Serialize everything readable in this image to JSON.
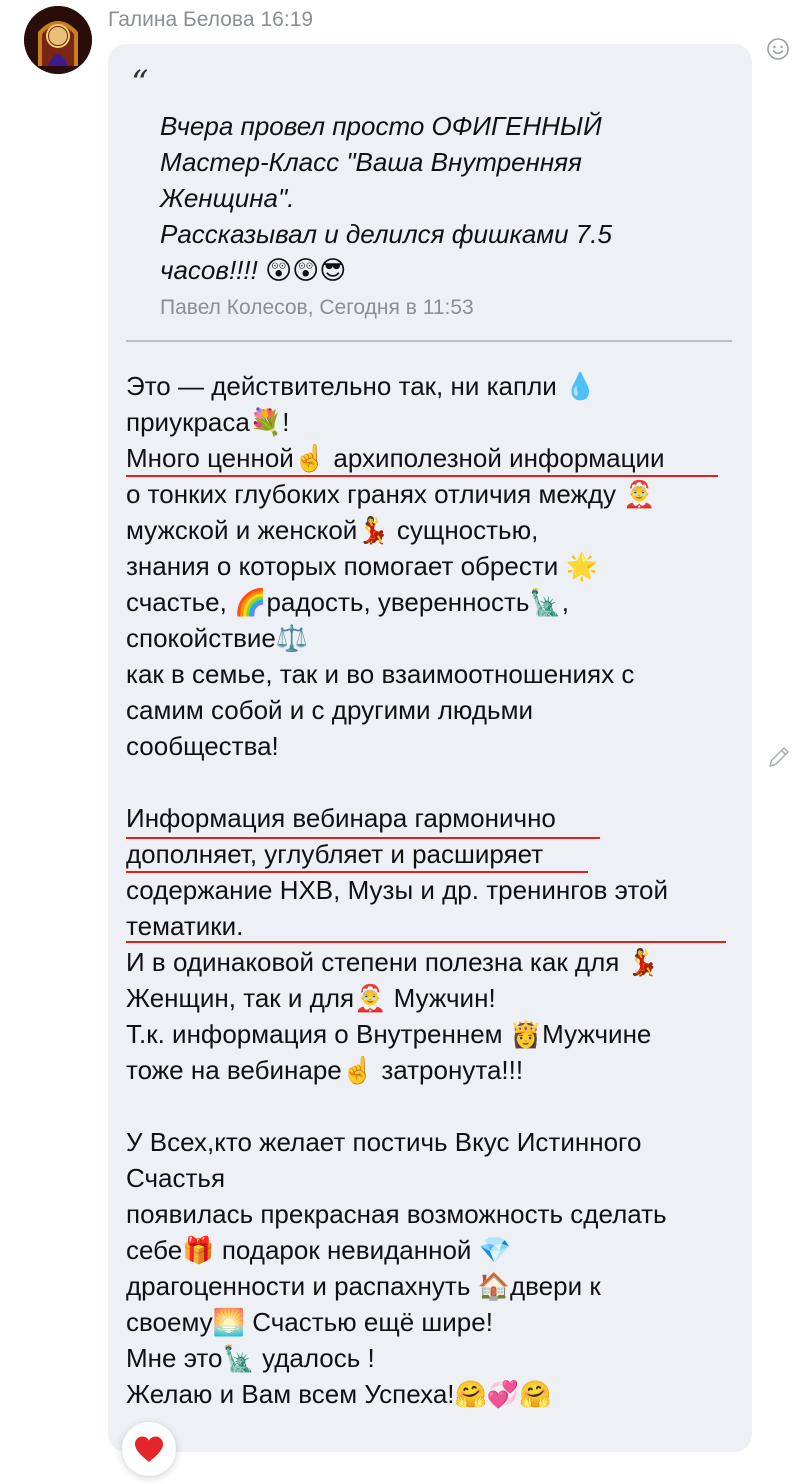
{
  "header": {
    "author": "Галина Белова",
    "time": "16:19"
  },
  "quote": {
    "mark": "“",
    "lines": [
      "Вчера провел просто ОФИГЕННЫЙ",
      "Мастер-Класс \"Ваша Внутренняя",
      "Женщина\".",
      "Рассказывал и делился фишками 7.5",
      "часов!!!! 😲😲😎"
    ],
    "author": "Павел Колесов, Сегодня в 11:53"
  },
  "message": {
    "lines": [
      "Это — действительно так, ни капли 💧",
      "приукраса💐!",
      "Много ценной☝️ архиполезной информации",
      "о тонких глубоких гранях отличия между 🤶",
      "мужской и женской💃 сущностью,",
      "знания о которых помогает обрести 🌟",
      "счастье, 🌈радость, уверенность🗽,",
      "спокойствие⚖️",
      "как в семье, так и во взаимоотношениях с",
      "самим собой и с другими людьми",
      "сообщества!",
      "",
      "Информация вебинара гармонично",
      "дополняет, углубляет и расширяет",
      "содержание НХВ, Музы и др. тренингов этой",
      "тематики.",
      "И в одинаковой степени полезна как для 💃",
      "Женщин, так и для🤶 Мужчин!",
      "Т.к. информация о Внутреннем 👸Мужчине",
      "тоже на вебинаре☝️ затронута!!!",
      "",
      "У Всех,кто желает постичь Вкус Истинного",
      "Счастья",
      "появилась прекрасная возможность сделать",
      "себе🎁 подарок невиданной 💎",
      "драгоценности и распахнуть 🏠двери к",
      "своему🌅 Счастью ещё шире!",
      "Мне это🗽 удалось !",
      "Желаю и Вам всем Успеха!🤗💞🤗"
    ]
  },
  "icons": {
    "smile": "smile-icon",
    "edit": "pencil-icon",
    "like": "heart-icon",
    "like_color": "#e5252a",
    "underline_color": "#e0201c",
    "bubble_color": "#edf0f5"
  }
}
